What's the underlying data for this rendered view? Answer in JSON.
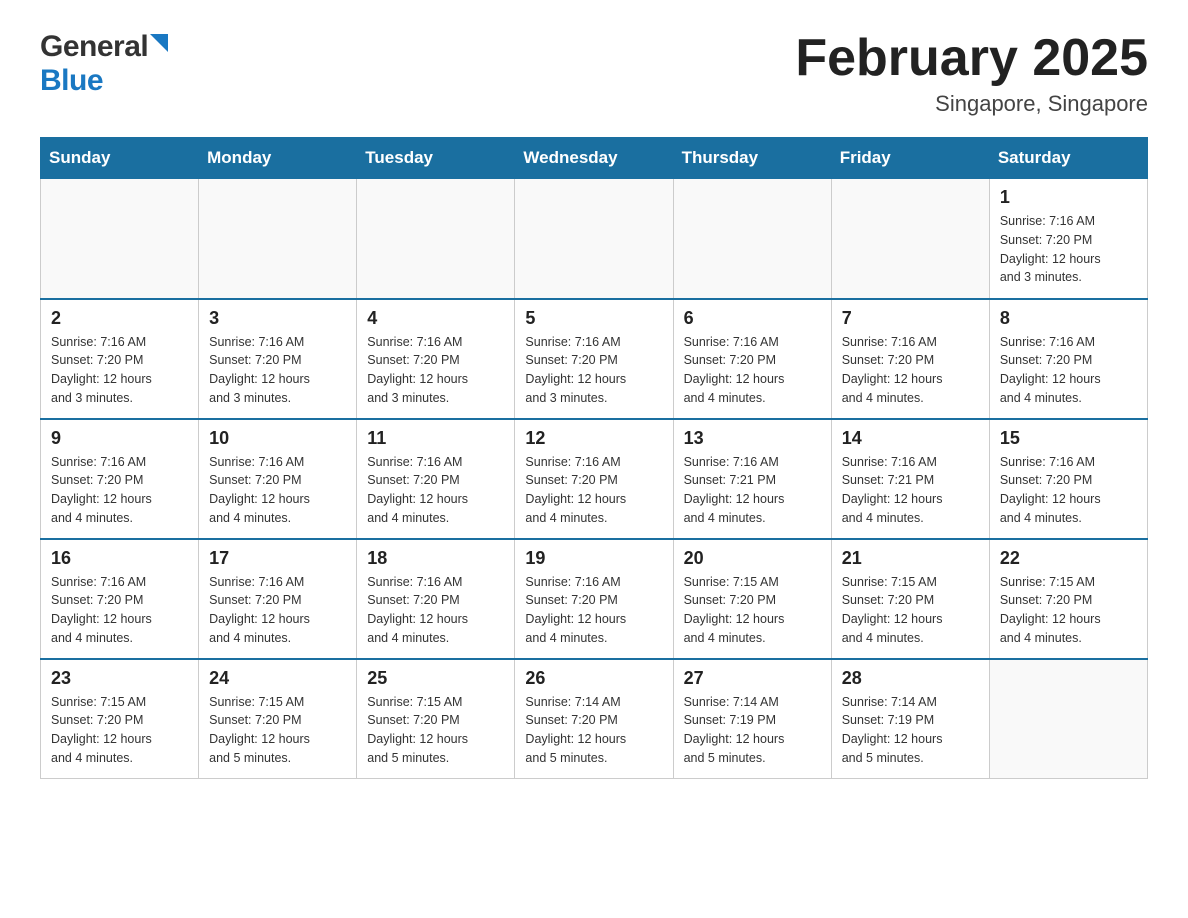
{
  "header": {
    "logo_general": "General",
    "logo_blue": "Blue",
    "title": "February 2025",
    "subtitle": "Singapore, Singapore"
  },
  "days_of_week": [
    "Sunday",
    "Monday",
    "Tuesday",
    "Wednesday",
    "Thursday",
    "Friday",
    "Saturday"
  ],
  "weeks": [
    {
      "days": [
        {
          "date": "",
          "info": ""
        },
        {
          "date": "",
          "info": ""
        },
        {
          "date": "",
          "info": ""
        },
        {
          "date": "",
          "info": ""
        },
        {
          "date": "",
          "info": ""
        },
        {
          "date": "",
          "info": ""
        },
        {
          "date": "1",
          "info": "Sunrise: 7:16 AM\nSunset: 7:20 PM\nDaylight: 12 hours\nand 3 minutes."
        }
      ]
    },
    {
      "days": [
        {
          "date": "2",
          "info": "Sunrise: 7:16 AM\nSunset: 7:20 PM\nDaylight: 12 hours\nand 3 minutes."
        },
        {
          "date": "3",
          "info": "Sunrise: 7:16 AM\nSunset: 7:20 PM\nDaylight: 12 hours\nand 3 minutes."
        },
        {
          "date": "4",
          "info": "Sunrise: 7:16 AM\nSunset: 7:20 PM\nDaylight: 12 hours\nand 3 minutes."
        },
        {
          "date": "5",
          "info": "Sunrise: 7:16 AM\nSunset: 7:20 PM\nDaylight: 12 hours\nand 3 minutes."
        },
        {
          "date": "6",
          "info": "Sunrise: 7:16 AM\nSunset: 7:20 PM\nDaylight: 12 hours\nand 4 minutes."
        },
        {
          "date": "7",
          "info": "Sunrise: 7:16 AM\nSunset: 7:20 PM\nDaylight: 12 hours\nand 4 minutes."
        },
        {
          "date": "8",
          "info": "Sunrise: 7:16 AM\nSunset: 7:20 PM\nDaylight: 12 hours\nand 4 minutes."
        }
      ]
    },
    {
      "days": [
        {
          "date": "9",
          "info": "Sunrise: 7:16 AM\nSunset: 7:20 PM\nDaylight: 12 hours\nand 4 minutes."
        },
        {
          "date": "10",
          "info": "Sunrise: 7:16 AM\nSunset: 7:20 PM\nDaylight: 12 hours\nand 4 minutes."
        },
        {
          "date": "11",
          "info": "Sunrise: 7:16 AM\nSunset: 7:20 PM\nDaylight: 12 hours\nand 4 minutes."
        },
        {
          "date": "12",
          "info": "Sunrise: 7:16 AM\nSunset: 7:20 PM\nDaylight: 12 hours\nand 4 minutes."
        },
        {
          "date": "13",
          "info": "Sunrise: 7:16 AM\nSunset: 7:21 PM\nDaylight: 12 hours\nand 4 minutes."
        },
        {
          "date": "14",
          "info": "Sunrise: 7:16 AM\nSunset: 7:21 PM\nDaylight: 12 hours\nand 4 minutes."
        },
        {
          "date": "15",
          "info": "Sunrise: 7:16 AM\nSunset: 7:20 PM\nDaylight: 12 hours\nand 4 minutes."
        }
      ]
    },
    {
      "days": [
        {
          "date": "16",
          "info": "Sunrise: 7:16 AM\nSunset: 7:20 PM\nDaylight: 12 hours\nand 4 minutes."
        },
        {
          "date": "17",
          "info": "Sunrise: 7:16 AM\nSunset: 7:20 PM\nDaylight: 12 hours\nand 4 minutes."
        },
        {
          "date": "18",
          "info": "Sunrise: 7:16 AM\nSunset: 7:20 PM\nDaylight: 12 hours\nand 4 minutes."
        },
        {
          "date": "19",
          "info": "Sunrise: 7:16 AM\nSunset: 7:20 PM\nDaylight: 12 hours\nand 4 minutes."
        },
        {
          "date": "20",
          "info": "Sunrise: 7:15 AM\nSunset: 7:20 PM\nDaylight: 12 hours\nand 4 minutes."
        },
        {
          "date": "21",
          "info": "Sunrise: 7:15 AM\nSunset: 7:20 PM\nDaylight: 12 hours\nand 4 minutes."
        },
        {
          "date": "22",
          "info": "Sunrise: 7:15 AM\nSunset: 7:20 PM\nDaylight: 12 hours\nand 4 minutes."
        }
      ]
    },
    {
      "days": [
        {
          "date": "23",
          "info": "Sunrise: 7:15 AM\nSunset: 7:20 PM\nDaylight: 12 hours\nand 4 minutes."
        },
        {
          "date": "24",
          "info": "Sunrise: 7:15 AM\nSunset: 7:20 PM\nDaylight: 12 hours\nand 5 minutes."
        },
        {
          "date": "25",
          "info": "Sunrise: 7:15 AM\nSunset: 7:20 PM\nDaylight: 12 hours\nand 5 minutes."
        },
        {
          "date": "26",
          "info": "Sunrise: 7:14 AM\nSunset: 7:20 PM\nDaylight: 12 hours\nand 5 minutes."
        },
        {
          "date": "27",
          "info": "Sunrise: 7:14 AM\nSunset: 7:19 PM\nDaylight: 12 hours\nand 5 minutes."
        },
        {
          "date": "28",
          "info": "Sunrise: 7:14 AM\nSunset: 7:19 PM\nDaylight: 12 hours\nand 5 minutes."
        },
        {
          "date": "",
          "info": ""
        }
      ]
    }
  ]
}
